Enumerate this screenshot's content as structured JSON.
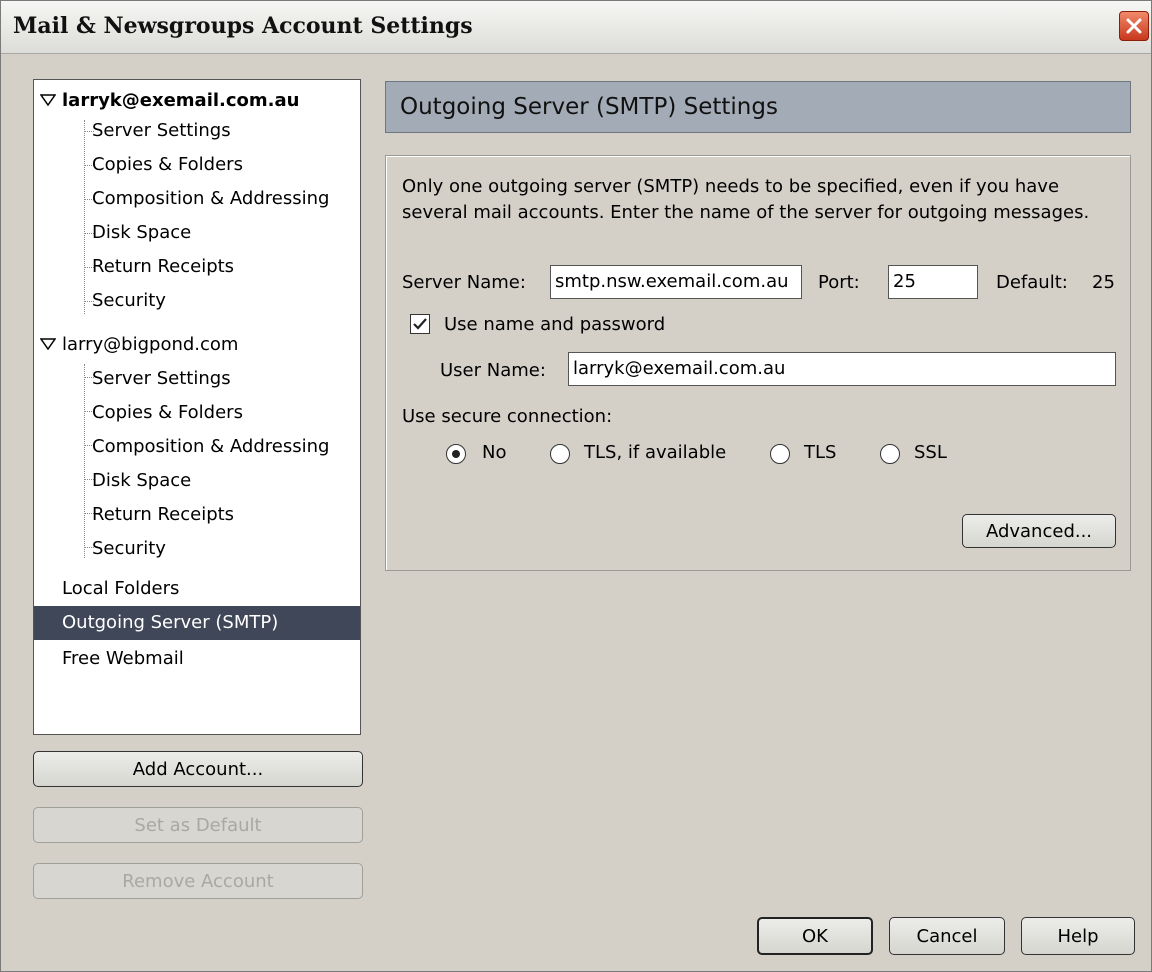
{
  "window": {
    "title": "Mail & Newsgroups Account Settings"
  },
  "tree": {
    "accounts": [
      {
        "name": "larryk@exemail.com.au",
        "bold": true,
        "children": [
          "Server Settings",
          "Copies & Folders",
          "Composition & Addressing",
          "Disk Space",
          "Return Receipts",
          "Security"
        ]
      },
      {
        "name": "larry@bigpond.com",
        "bold": false,
        "children": [
          "Server Settings",
          "Copies & Folders",
          "Composition & Addressing",
          "Disk Space",
          "Return Receipts",
          "Security"
        ]
      }
    ],
    "top_items": [
      "Local Folders",
      "Outgoing Server (SMTP)",
      "Free Webmail"
    ],
    "selected": "Outgoing Server (SMTP)"
  },
  "left_buttons": {
    "add_account": "Add Account...",
    "set_default": "Set as Default",
    "remove_account": "Remove Account"
  },
  "panel": {
    "heading": "Outgoing Server (SMTP) Settings",
    "description_line1": "Only one outgoing server (SMTP) needs to be specified, even if you have",
    "description_line2": "several mail accounts. Enter the name of the server for outgoing messages.",
    "server_name_label": "Server Name:",
    "server_name_value": "smtp.nsw.exemail.com.au",
    "port_label": "Port:",
    "port_value": "25",
    "default_label": "Default:",
    "default_value": "25",
    "use_name_password_label": "Use name and password",
    "use_name_password_checked": true,
    "user_name_label": "User Name:",
    "user_name_value": "larryk@exemail.com.au",
    "secure_connection_label": "Use secure connection:",
    "secure_options": [
      "No",
      "TLS, if available",
      "TLS",
      "SSL"
    ],
    "secure_selected": "No",
    "advanced_button": "Advanced..."
  },
  "dialog_buttons": {
    "ok": "OK",
    "cancel": "Cancel",
    "help": "Help"
  }
}
